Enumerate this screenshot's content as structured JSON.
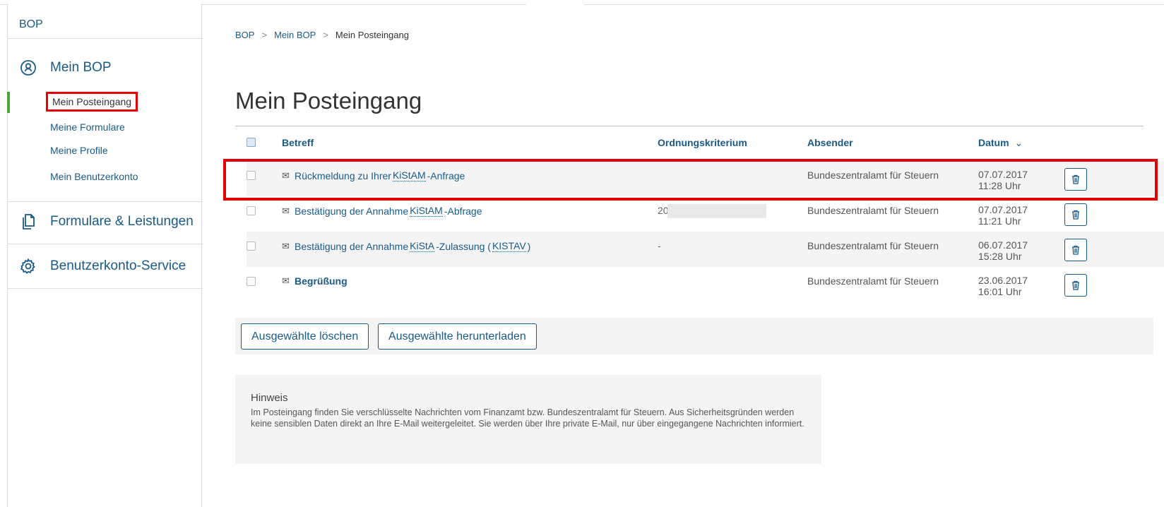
{
  "sidebar": {
    "brand": "BOP",
    "sections": [
      {
        "label": "Mein BOP",
        "icon": "user-circle-icon"
      },
      {
        "label": "Formulare & Leistungen",
        "icon": "documents-icon"
      },
      {
        "label": "Benutzerkonto-Service",
        "icon": "gear-icon"
      }
    ],
    "sub_items": [
      "Mein Posteingang",
      "Meine Formulare",
      "Meine Profile",
      "Mein Benutzerkonto"
    ],
    "active_item": "Mein Posteingang"
  },
  "breadcrumb": [
    "BOP",
    "Mein BOP",
    "Mein Posteingang"
  ],
  "page_title": "Mein Posteingang",
  "table": {
    "columns": {
      "subject": "Betreff",
      "criterion": "Ordnungskriterium",
      "sender": "Absender",
      "date": "Datum"
    },
    "sort_indicator": "chevron-down-icon",
    "rows": [
      {
        "subject_pre": "Rückmeldung zu Ihrer ",
        "subject_abbr": "KiStAM",
        "subject_post": "-Anfrage",
        "criterion": "",
        "sender": "Bundeszentralamt für Steuern",
        "date": "07.07.2017",
        "time": "11:28 Uhr",
        "read": true
      },
      {
        "subject_pre": "Bestätigung der Annahme ",
        "subject_abbr": "KiStAM",
        "subject_post": "-Abfrage",
        "criterion": "200(",
        "sender": "Bundeszentralamt für Steuern",
        "date": "07.07.2017",
        "time": "11:21 Uhr",
        "read": true
      },
      {
        "subject_pre": "Bestätigung der Annahme ",
        "subject_abbr": "KiStA",
        "subject_post": "-Zulassung (",
        "subject_abbr2": "KISTAV",
        "subject_post2": ")",
        "criterion": "-",
        "sender": "Bundeszentralamt für Steuern",
        "date": "06.07.2017",
        "time": "15:28 Uhr",
        "read": true
      },
      {
        "subject_pre": "Begrüßung",
        "criterion": "",
        "sender": "Bundeszentralamt für Steuern",
        "date": "23.06.2017",
        "time": "16:01 Uhr",
        "read": false
      }
    ]
  },
  "actions": {
    "delete_selected": "Ausgewählte löschen",
    "download_selected": "Ausgewählte herunterladen"
  },
  "notice": {
    "title": "Hinweis",
    "text": "Im Posteingang finden Sie verschlüsselte Nachrichten vom Finanzamt bzw. Bundeszentralamt für Steuern. Aus Sicherheitsgründen werden keine sensiblen Daten direkt an Ihre E-Mail weitergeleitet. Sie werden über Ihre private E-Mail, nur über eingegangene Nachrichten informiert."
  },
  "colors": {
    "link": "#1a5a87",
    "highlight": "#e30000",
    "active_bar": "#4aa63a"
  }
}
